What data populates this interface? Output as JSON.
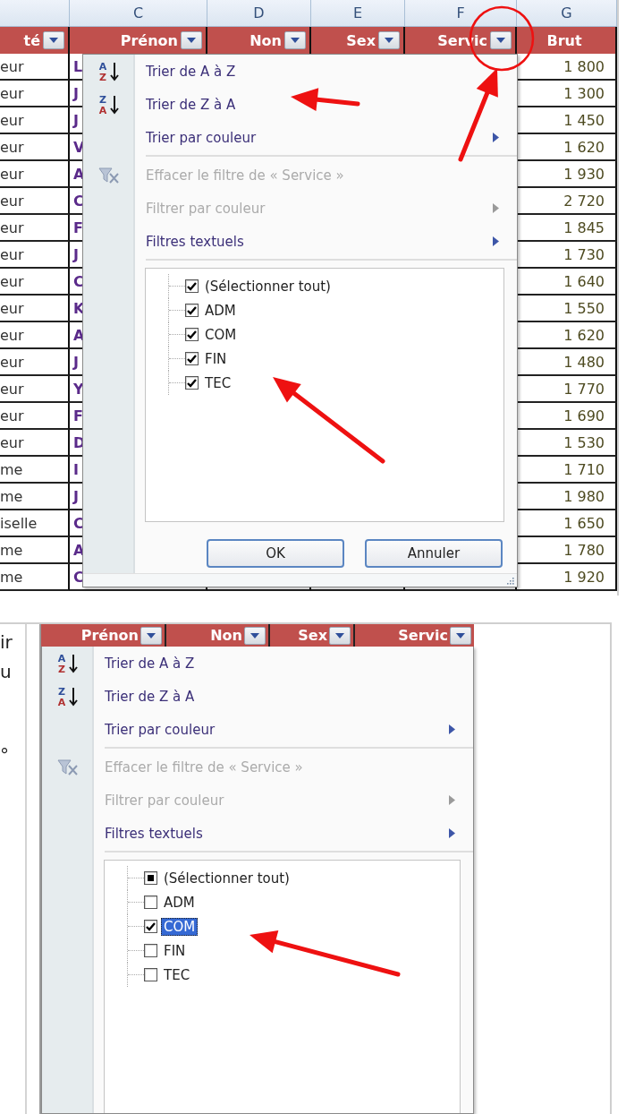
{
  "top_panel": {
    "column_letters": [
      "C",
      "D",
      "E",
      "F",
      "G"
    ],
    "header": [
      {
        "label": "té",
        "filter": true
      },
      {
        "label": "Prénon",
        "filter": true
      },
      {
        "label": "Non",
        "filter": true
      },
      {
        "label": "Sex",
        "filter": true
      },
      {
        "label": "Servic",
        "filter": true
      },
      {
        "label": "Brut",
        "filter": false
      }
    ],
    "rows": [
      {
        "cells": [
          "eur",
          "L",
          "1 800"
        ]
      },
      {
        "cells": [
          "eur",
          "J",
          "1 300"
        ]
      },
      {
        "cells": [
          "eur",
          "J",
          "1 450"
        ]
      },
      {
        "cells": [
          "eur",
          "V",
          "1 620"
        ]
      },
      {
        "cells": [
          "eur",
          "A",
          "1 930"
        ]
      },
      {
        "cells": [
          "eur",
          "C",
          "2 720"
        ]
      },
      {
        "cells": [
          "eur",
          "F",
          "1 845"
        ]
      },
      {
        "cells": [
          "eur",
          "J",
          "1 730"
        ]
      },
      {
        "cells": [
          "eur",
          "C",
          "1 640"
        ]
      },
      {
        "cells": [
          "eur",
          "K",
          "1 550"
        ]
      },
      {
        "cells": [
          "eur",
          "A",
          "1 620"
        ]
      },
      {
        "cells": [
          "eur",
          "J",
          "1 480"
        ]
      },
      {
        "cells": [
          "eur",
          "Y",
          "1 770"
        ]
      },
      {
        "cells": [
          "eur",
          "F",
          "1 690"
        ]
      },
      {
        "cells": [
          "eur",
          "D",
          "1 530"
        ]
      },
      {
        "cells": [
          "me",
          "I",
          "1 710"
        ]
      },
      {
        "cells": [
          "me",
          "J",
          "1 980"
        ]
      },
      {
        "cells": [
          "iselle",
          "C",
          "1 650"
        ]
      },
      {
        "cells": [
          "me",
          "A",
          "1 780"
        ]
      },
      {
        "cells": [
          "me",
          "C",
          "1 920"
        ]
      }
    ],
    "filter_menu": {
      "items": [
        {
          "kind": "sort-asc",
          "icon_letters": [
            "A",
            "Z"
          ],
          "label": "Trier de A à Z",
          "disabled": false,
          "submenu": false,
          "separator_after": false
        },
        {
          "kind": "sort-desc",
          "icon_letters": [
            "Z",
            "A"
          ],
          "label": "Trier de Z à A",
          "disabled": false,
          "submenu": false,
          "separator_after": false
        },
        {
          "kind": "plain",
          "label": "Trier par couleur",
          "disabled": false,
          "submenu": true,
          "separator_after": true
        },
        {
          "kind": "clear-filter",
          "label": "Effacer le filtre de « Service »",
          "disabled": true,
          "submenu": false,
          "separator_after": false
        },
        {
          "kind": "plain",
          "label": "Filtrer par couleur",
          "disabled": true,
          "submenu": true,
          "separator_after": false
        },
        {
          "kind": "plain",
          "label": "Filtres textuels",
          "disabled": false,
          "submenu": true,
          "separator_after": true
        }
      ],
      "values": [
        {
          "label": "(Sélectionner tout)",
          "checked": true,
          "indeterminate": false,
          "selected": false
        },
        {
          "label": "ADM",
          "checked": true,
          "indeterminate": false,
          "selected": false
        },
        {
          "label": "COM",
          "checked": true,
          "indeterminate": false,
          "selected": false
        },
        {
          "label": "FIN",
          "checked": true,
          "indeterminate": false,
          "selected": false
        },
        {
          "label": "TEC",
          "checked": true,
          "indeterminate": false,
          "selected": false
        }
      ],
      "buttons": [
        "OK",
        "Annuler"
      ]
    }
  },
  "bottom_panel": {
    "side_text": [
      "ir",
      "u",
      "°"
    ],
    "header": [
      {
        "label": "Prénon",
        "filter": true
      },
      {
        "label": "Non",
        "filter": true
      },
      {
        "label": "Sex",
        "filter": true
      },
      {
        "label": "Servic",
        "filter": true
      }
    ],
    "filter_menu": {
      "items": [
        {
          "kind": "sort-asc",
          "icon_letters": [
            "A",
            "Z"
          ],
          "label": "Trier de A à Z",
          "disabled": false,
          "submenu": false,
          "separator_after": false
        },
        {
          "kind": "sort-desc",
          "icon_letters": [
            "Z",
            "A"
          ],
          "label": "Trier de Z à A",
          "disabled": false,
          "submenu": false,
          "separator_after": false
        },
        {
          "kind": "plain",
          "label": "Trier par couleur",
          "disabled": false,
          "submenu": true,
          "separator_after": true
        },
        {
          "kind": "clear-filter",
          "label": "Effacer le filtre de « Service »",
          "disabled": true,
          "submenu": false,
          "separator_after": false
        },
        {
          "kind": "plain",
          "label": "Filtrer par couleur",
          "disabled": true,
          "submenu": true,
          "separator_after": false
        },
        {
          "kind": "plain",
          "label": "Filtres textuels",
          "disabled": false,
          "submenu": true,
          "separator_after": true
        }
      ],
      "values": [
        {
          "label": "(Sélectionner tout)",
          "checked": false,
          "indeterminate": true,
          "selected": false
        },
        {
          "label": "ADM",
          "checked": false,
          "indeterminate": false,
          "selected": false
        },
        {
          "label": "COM",
          "checked": true,
          "indeterminate": false,
          "selected": true
        },
        {
          "label": "FIN",
          "checked": false,
          "indeterminate": false,
          "selected": false
        },
        {
          "label": "TEC",
          "checked": false,
          "indeterminate": false,
          "selected": false
        }
      ]
    }
  }
}
